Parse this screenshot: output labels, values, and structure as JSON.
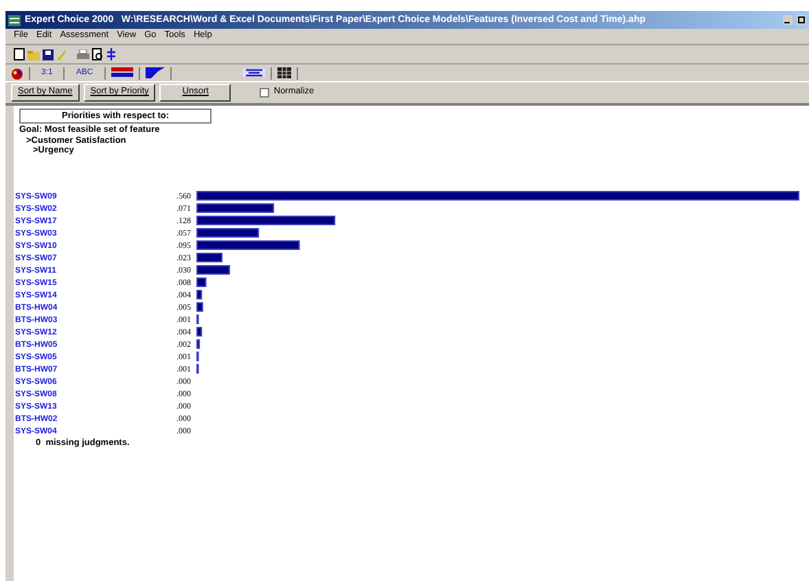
{
  "window": {
    "title": "Expert Choice 2000   W:\\RESEARCH\\Word & Excel Documents\\First Paper\\Expert Choice Models\\Features (Inversed Cost and Time).ahp"
  },
  "menu": [
    "File",
    "Edit",
    "Assessment",
    "View",
    "Go",
    "Tools",
    "Help"
  ],
  "view_tabs": [
    {
      "label": "3:1",
      "selected": false
    },
    {
      "label": "ABC",
      "selected": false
    }
  ],
  "buttons": [
    "Sort by Name",
    "Sort by Priority",
    "Unsort"
  ],
  "normalize": {
    "label": "Normalize",
    "checked": false
  },
  "header": "Priorities with respect to:",
  "goal": {
    "label": "Goal: Most feasible set of feature",
    "children": [
      {
        "label": ">Customer Satisfaction",
        "children": [
          {
            "label": ">Urgency"
          }
        ]
      }
    ]
  },
  "priorities": {
    "chart_data": {
      "type": "bar",
      "orientation": "horizontal",
      "value_labels": [
        ".560",
        ".071",
        ".128",
        ".057",
        ".095",
        ".023",
        ".030",
        ".008",
        ".004",
        ".005",
        ".001",
        ".004",
        ".002",
        ".001",
        ".001",
        ".000",
        ".000",
        ".000",
        ".000",
        ".000"
      ],
      "categories": [
        "SYS-SW09",
        "SYS-SW02",
        "SYS-SW17",
        "SYS-SW03",
        "SYS-SW10",
        "SYS-SW07",
        "SYS-SW11",
        "SYS-SW15",
        "SYS-SW14",
        "BTS-HW04",
        "BTS-HW03",
        "SYS-SW12",
        "BTS-HW05",
        "SYS-SW05",
        "BTS-HW07",
        "SYS-SW06",
        "SYS-SW08",
        "SYS-SW13",
        "BTS-HW02",
        "SYS-SW04"
      ],
      "values": [
        0.56,
        0.071,
        0.128,
        0.057,
        0.095,
        0.023,
        0.03,
        0.008,
        0.004,
        0.005,
        0.001,
        0.004,
        0.002,
        0.001,
        0.001,
        0.0,
        0.0,
        0.0,
        0.0,
        0.0
      ]
    }
  },
  "footer": "0  missing judgments."
}
